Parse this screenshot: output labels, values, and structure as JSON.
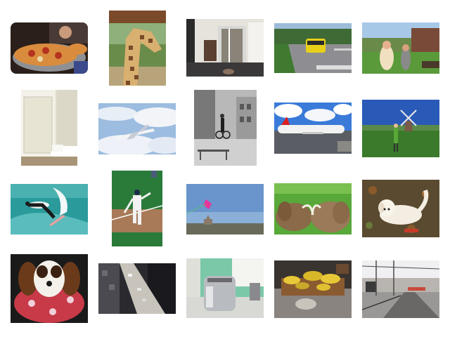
{
  "gallery": {
    "items": [
      {
        "name": "pizza-photo",
        "subject": "pizza"
      },
      {
        "name": "giraffe-photo",
        "subject": "giraffe"
      },
      {
        "name": "living-room-photo",
        "subject": "room"
      },
      {
        "name": "bus-street-photo",
        "subject": "bus"
      },
      {
        "name": "women-park-photo",
        "subject": "park"
      },
      {
        "name": "bathroom-photo",
        "subject": "bathroom"
      },
      {
        "name": "airplane-sky-photo",
        "subject": "airplane"
      },
      {
        "name": "cyclist-street-photo",
        "subject": "cyclist"
      },
      {
        "name": "airliner-runway-photo",
        "subject": "airliner"
      },
      {
        "name": "windmill-field-photo",
        "subject": "windmill"
      },
      {
        "name": "surfer-photo",
        "subject": "surfer"
      },
      {
        "name": "baseball-player-photo",
        "subject": "baseball"
      },
      {
        "name": "kite-sky-photo",
        "subject": "kite"
      },
      {
        "name": "elephants-photo",
        "subject": "elephants"
      },
      {
        "name": "white-dog-photo",
        "subject": "dog"
      },
      {
        "name": "spaniel-photo",
        "subject": "spaniel"
      },
      {
        "name": "city-street-aerial-photo",
        "subject": "street"
      },
      {
        "name": "toaster-photo",
        "subject": "toaster"
      },
      {
        "name": "bananas-photo",
        "subject": "bananas"
      },
      {
        "name": "railway-photo",
        "subject": "railway"
      }
    ]
  }
}
